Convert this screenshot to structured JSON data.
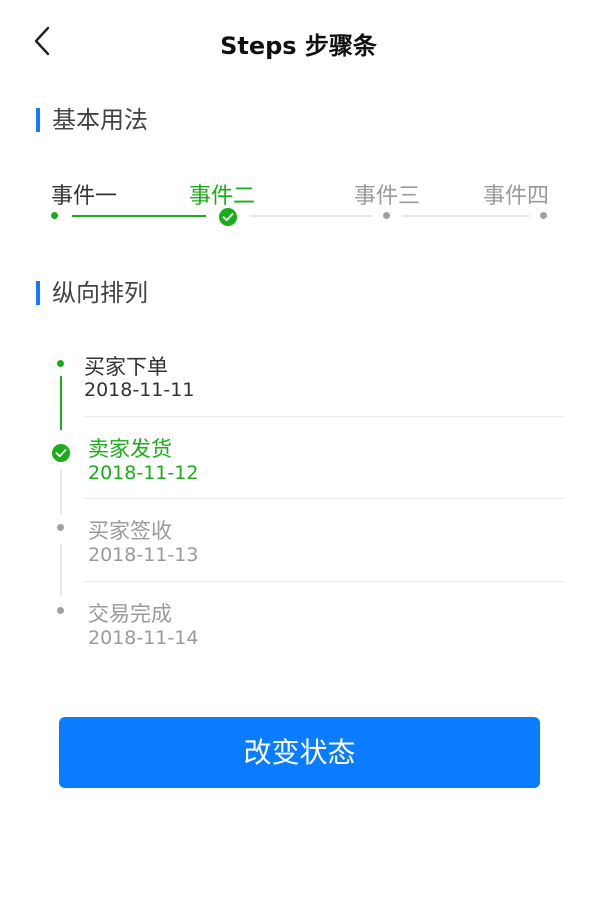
{
  "header": {
    "title": "Steps 步骤条"
  },
  "icons": {
    "back": "chevron-left-icon",
    "check": "check-circle-icon"
  },
  "colors": {
    "active": "#1aad19",
    "todo": "#9a9a9a",
    "accent": "#1677ff",
    "button": "#0a7cff"
  },
  "basic": {
    "title": "基本用法",
    "steps": [
      {
        "label": "事件一",
        "status": "finish"
      },
      {
        "label": "事件二",
        "status": "process"
      },
      {
        "label": "事件三",
        "status": "wait"
      },
      {
        "label": "事件四",
        "status": "wait"
      }
    ]
  },
  "vertical": {
    "title": "纵向排列",
    "steps": [
      {
        "label": "买家下单",
        "date": "2018-11-11",
        "status": "finish"
      },
      {
        "label": "卖家发货",
        "date": "2018-11-12",
        "status": "process"
      },
      {
        "label": "买家签收",
        "date": "2018-11-13",
        "status": "wait"
      },
      {
        "label": "交易完成",
        "date": "2018-11-14",
        "status": "wait"
      }
    ]
  },
  "action": {
    "label": "改变状态"
  }
}
